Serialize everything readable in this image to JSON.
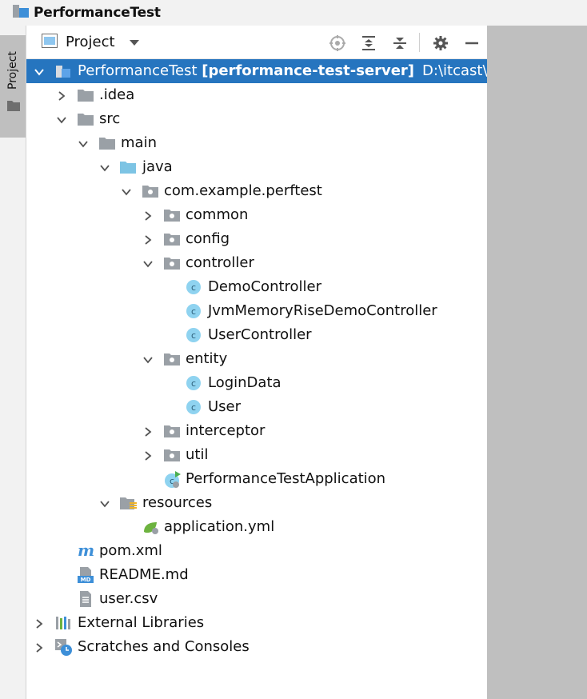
{
  "window": {
    "title": "PerformanceTest"
  },
  "tool_stripe": {
    "tab_label": "Project"
  },
  "panel": {
    "view_title": "Project",
    "buttons": [
      "locate-icon",
      "expand-all-icon",
      "collapse-all-icon",
      "gear-icon",
      "minimize-icon"
    ]
  },
  "tree": {
    "root": {
      "name": "PerformanceTest",
      "module": "[performance-test-server]",
      "path": "D:\\itcast\\"
    },
    "items": [
      {
        "label": ".idea"
      },
      {
        "label": "src"
      },
      {
        "label": "main"
      },
      {
        "label": "java"
      },
      {
        "label": "com.example.perftest"
      },
      {
        "label": "common"
      },
      {
        "label": "config"
      },
      {
        "label": "controller"
      },
      {
        "label": "DemoController"
      },
      {
        "label": "JvmMemoryRiseDemoController"
      },
      {
        "label": "UserController"
      },
      {
        "label": "entity"
      },
      {
        "label": "LoginData"
      },
      {
        "label": "User"
      },
      {
        "label": "interceptor"
      },
      {
        "label": "util"
      },
      {
        "label": "PerformanceTestApplication"
      },
      {
        "label": "resources"
      },
      {
        "label": "application.yml"
      },
      {
        "label": "pom.xml"
      },
      {
        "label": "README.md"
      },
      {
        "label": "user.csv"
      },
      {
        "label": "External Libraries"
      },
      {
        "label": "Scratches and Consoles"
      }
    ]
  },
  "colors": {
    "selection": "#2675bf",
    "folder": "#9aa0a6",
    "source_folder": "#7dc4e4",
    "class_icon": "#40b6e0"
  }
}
